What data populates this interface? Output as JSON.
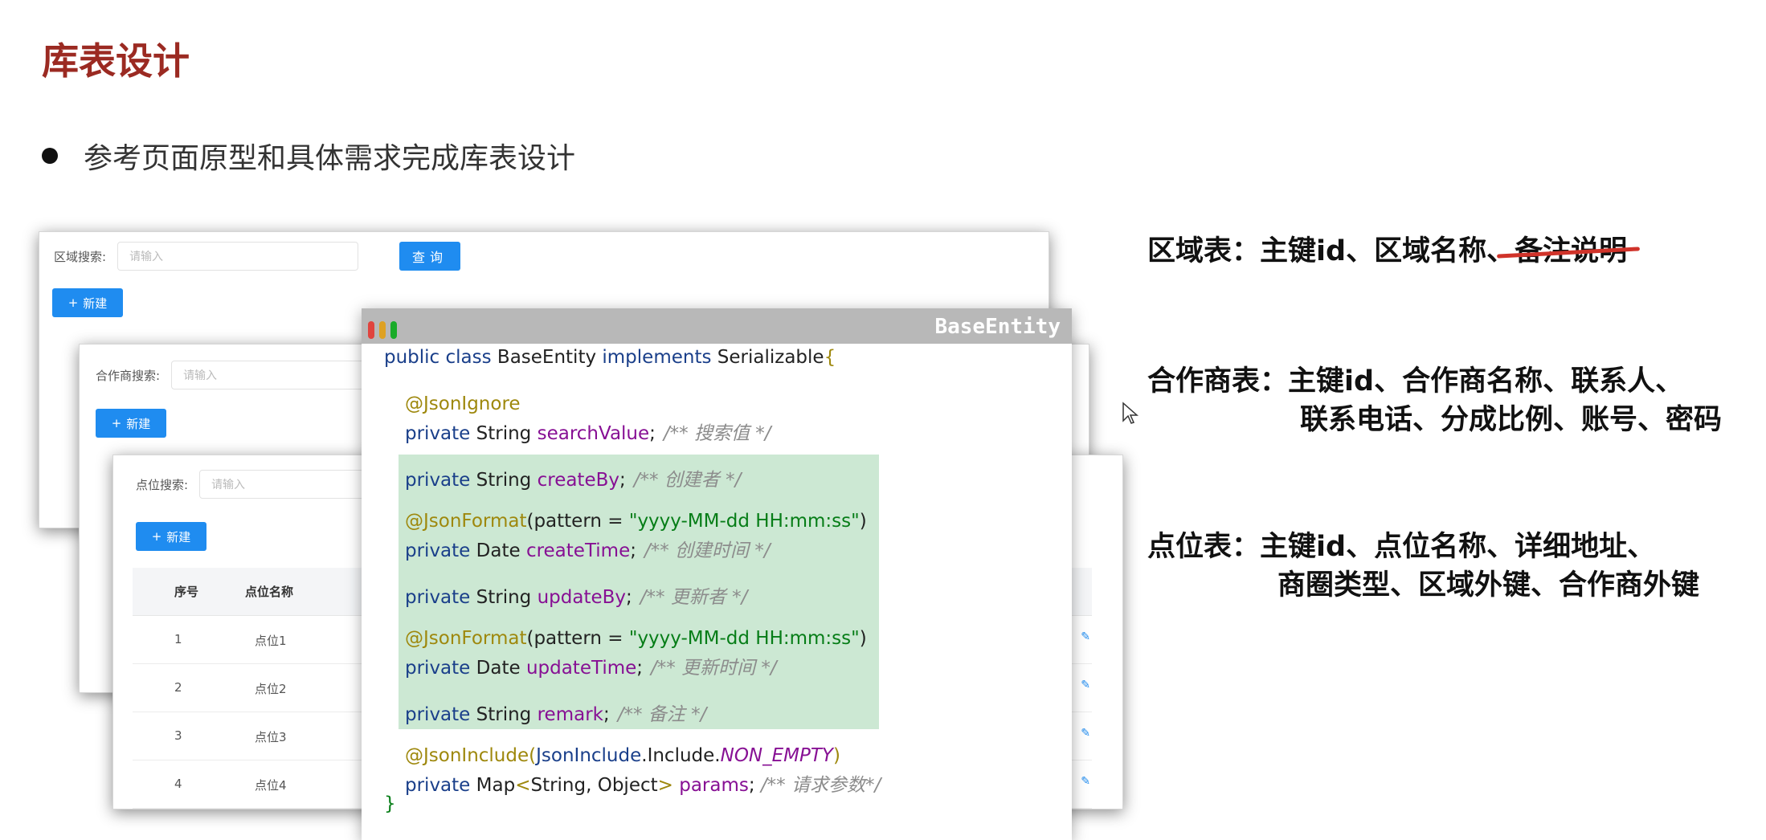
{
  "slide": {
    "title": "库表设计",
    "bullet": "参考页面原型和具体需求完成库表设计"
  },
  "prototype": {
    "region_panel": {
      "search_label": "区域搜索:",
      "search_placeholder": "请输入",
      "query_button": "查询",
      "new_button": "新建"
    },
    "partner_panel": {
      "search_label": "合作商搜索:",
      "search_placeholder": "请输入",
      "new_button": "新建"
    },
    "point_panel": {
      "search_label": "点位搜索:",
      "search_placeholder": "请输入",
      "new_button": "新建",
      "columns": [
        "序号",
        "点位名称"
      ],
      "rows": [
        {
          "no": "1",
          "name": "点位1"
        },
        {
          "no": "2",
          "name": "点位2"
        },
        {
          "no": "3",
          "name": "点位3"
        },
        {
          "no": "4",
          "name": "点位4"
        }
      ]
    }
  },
  "code_window": {
    "title": "BaseEntity",
    "class_decl": {
      "mod": "public class ",
      "name": "BaseEntity ",
      "impl": "implements ",
      "iface": "Serializable",
      "brace": "{"
    },
    "json_ignore": "@JsonIgnore",
    "search_value": {
      "mod": "private ",
      "type": "String ",
      "field": "searchValue",
      "semi": ";",
      "comment": "/** 搜索值 */"
    },
    "create_by": {
      "mod": "private ",
      "type": "String ",
      "field": "createBy",
      "semi": ";",
      "comment": "/** 创建者 */"
    },
    "json_format_1": {
      "ann": "@JsonFormat",
      "open": "(pattern = ",
      "str": "\"yyyy-MM-dd HH:mm:ss\"",
      "close": ")"
    },
    "create_time": {
      "mod": "private ",
      "type": "Date ",
      "field": "createTime",
      "semi": ";",
      "comment": "/** 创建时间 */"
    },
    "update_by": {
      "mod": "private ",
      "type": "String ",
      "field": "updateBy",
      "semi": ";",
      "comment": "/** 更新者 */"
    },
    "json_format_2": {
      "ann": "@JsonFormat",
      "open": "(pattern = ",
      "str": "\"yyyy-MM-dd HH:mm:ss\"",
      "close": ")"
    },
    "update_time": {
      "mod": "private ",
      "type": "Date ",
      "field": "updateTime",
      "semi": ";",
      "comment": "/** 更新时间 */"
    },
    "remark": {
      "mod": "private ",
      "type": "String ",
      "field": "remark",
      "semi": ";",
      "comment": "/** 备注 */"
    },
    "json_include": {
      "ann": "@JsonInclude",
      "open": "(",
      "cls": "JsonInclude",
      "mid": ".Include.",
      "enum": "NON_EMPTY",
      "close": ")"
    },
    "params": {
      "mod": "private ",
      "type": "Map",
      "lt": "<",
      "generic": "String, Object",
      "gt": "> ",
      "field": "params",
      "semi": "; ",
      "comment": "/** 请求参数*/"
    },
    "closing_brace": "}"
  },
  "descriptions": {
    "region": {
      "label": "区域表：",
      "fields": "主键id、区域名称、",
      "struck": "备注说明"
    },
    "partner": {
      "label": "合作商表：",
      "line1": "主键id、合作商名称、联系人、",
      "line2": "联系电话、分成比例、账号、密码"
    },
    "point": {
      "label": "点位表：",
      "line1": "主键id、点位名称、详细地址、",
      "line2": "商圈类型、区域外键、合作商外键"
    }
  },
  "colors": {
    "title": "#9b2a22",
    "primary_button": "#1f8cf0",
    "code_highlight": "#cce8d3",
    "strike": "#d0332a"
  }
}
